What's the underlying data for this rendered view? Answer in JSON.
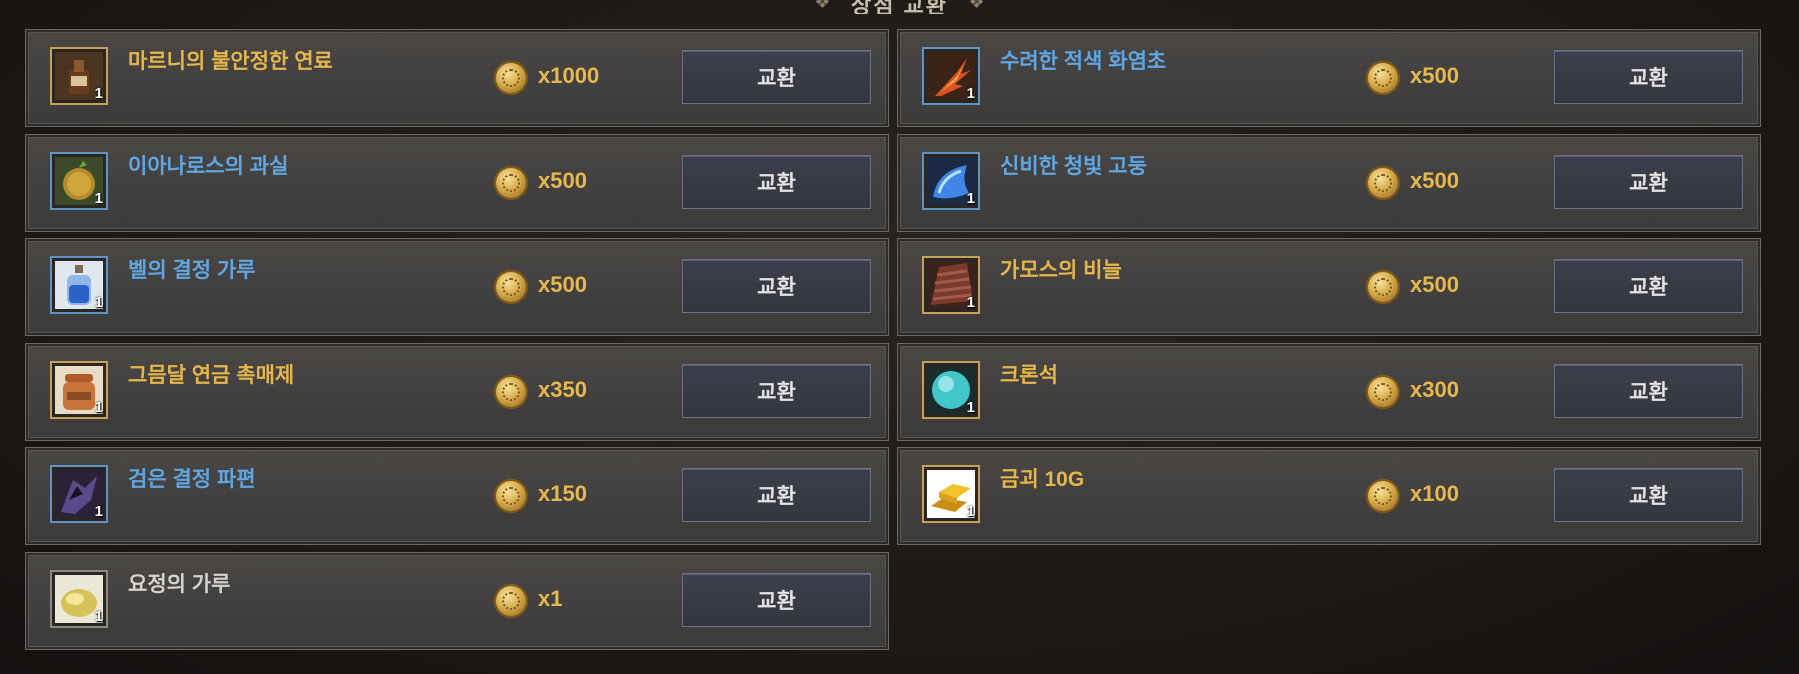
{
  "header": {
    "title": "상점 교환"
  },
  "button_label": "교환",
  "items": [
    {
      "name": "마르니의 불안정한 연료",
      "grade": "gold",
      "icon": "fuel-flask-icon",
      "qty": "1",
      "price": "x1000"
    },
    {
      "name": "수려한 적색 화염초",
      "grade": "blue",
      "icon": "red-flame-herb-icon",
      "qty": "1",
      "price": "x500"
    },
    {
      "name": "이아나로스의 과실",
      "grade": "blue",
      "icon": "spiky-fruit-icon",
      "qty": "1",
      "price": "x500"
    },
    {
      "name": "신비한 청빛 고둥",
      "grade": "blue",
      "icon": "blue-conch-shell-icon",
      "qty": "1",
      "price": "x500"
    },
    {
      "name": "벨의 결정 가루",
      "grade": "blue",
      "icon": "crystal-powder-bottle-icon",
      "qty": "1",
      "price": "x500"
    },
    {
      "name": "가모스의 비늘",
      "grade": "gold",
      "icon": "scale-icon",
      "qty": "1",
      "price": "x500"
    },
    {
      "name": "그믐달 연금 촉매제",
      "grade": "gold",
      "icon": "catalyst-jar-icon",
      "qty": "1",
      "price": "x350"
    },
    {
      "name": "크론석",
      "grade": "gold",
      "icon": "cron-stone-orb-icon",
      "qty": "1",
      "price": "x300"
    },
    {
      "name": "검은 결정 파편",
      "grade": "blue",
      "icon": "black-crystal-shard-icon",
      "qty": "1",
      "price": "x150"
    },
    {
      "name": "금괴 10G",
      "grade": "gold",
      "icon": "gold-bar-icon",
      "qty": "1",
      "price": "x100"
    },
    {
      "name": "요정의 가루",
      "grade": "gray",
      "icon": "fairy-powder-icon",
      "qty": "1",
      "price": "x1"
    }
  ],
  "colors": {
    "gold_grade": "#e5b64b",
    "blue_grade": "#5fa6e3",
    "gray_grade": "#d6d3cf",
    "price": "#e6b84e",
    "card_bg": "#474442"
  }
}
